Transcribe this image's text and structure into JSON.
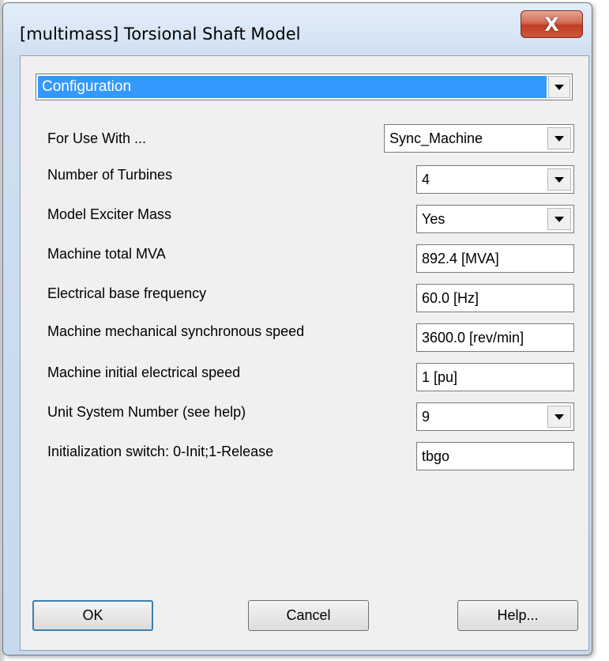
{
  "window": {
    "title": "[multimass] Torsional Shaft Model",
    "close_label": "X"
  },
  "section": {
    "selected": "Configuration"
  },
  "fields": [
    {
      "label": "For Use With ...",
      "value": "Sync_Machine",
      "kind": "dropdown"
    },
    {
      "label": "Number of Turbines",
      "value": "4",
      "kind": "dropdown"
    },
    {
      "label": "Model Exciter Mass",
      "value": "Yes",
      "kind": "dropdown"
    },
    {
      "label": "Machine total MVA",
      "value": "892.4 [MVA]",
      "kind": "text"
    },
    {
      "label": "Electrical base frequency",
      "value": "60.0 [Hz]",
      "kind": "text"
    },
    {
      "label": "Machine mechanical synchronous speed",
      "value": "3600.0 [rev/min]",
      "kind": "text"
    },
    {
      "label": "Machine initial electrical speed",
      "value": "1 [pu]",
      "kind": "text"
    },
    {
      "label": "Unit System Number (see help)",
      "value": "9",
      "kind": "dropdown"
    },
    {
      "label": "Initialization switch: 0-Init;1-Release",
      "value": "tbgo",
      "kind": "text"
    }
  ],
  "buttons": {
    "ok": "OK",
    "cancel": "Cancel",
    "help": "Help..."
  },
  "icons": {
    "dropdown": "chevron-down-icon",
    "close": "close-icon"
  }
}
